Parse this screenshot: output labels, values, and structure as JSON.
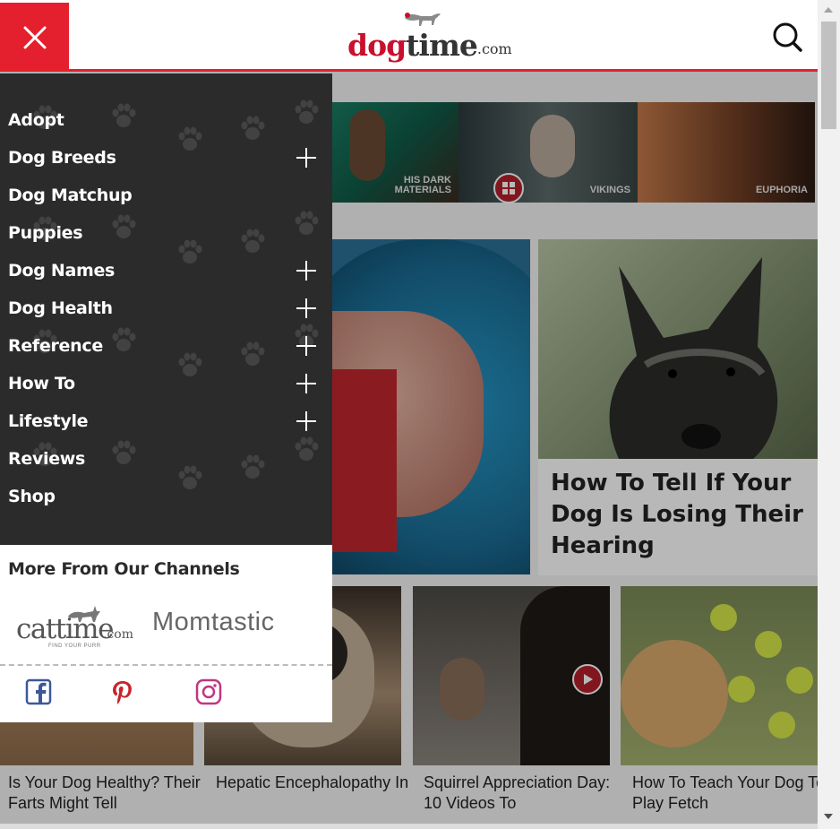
{
  "header": {
    "logo": {
      "dog": "dog",
      "time": "time",
      "com": ".com"
    },
    "close_icon": "close-icon",
    "search_icon": "search-icon"
  },
  "menu": {
    "items": [
      {
        "label": "Adopt",
        "expandable": false
      },
      {
        "label": "Dog Breeds",
        "expandable": true
      },
      {
        "label": "Dog Matchup",
        "expandable": false
      },
      {
        "label": "Puppies",
        "expandable": false
      },
      {
        "label": "Dog Names",
        "expandable": true
      },
      {
        "label": "Dog Health",
        "expandable": true
      },
      {
        "label": "Reference",
        "expandable": true
      },
      {
        "label": "How To",
        "expandable": true
      },
      {
        "label": "Lifestyle",
        "expandable": true
      },
      {
        "label": "Reviews",
        "expandable": false
      },
      {
        "label": "Shop",
        "expandable": false
      }
    ]
  },
  "channels": {
    "heading": "More From Our Channels",
    "cattime": {
      "word": "cattime",
      "com": ".com",
      "tagline": "FIND YOUR PURR"
    },
    "momtastic": "Momtastic",
    "social": [
      "facebook-icon",
      "pinterest-icon",
      "instagram-icon"
    ]
  },
  "content": {
    "strip": [
      {
        "label": "HIS DARK\nMATERIALS"
      },
      {
        "label": "VIKINGS"
      },
      {
        "label": "EUPHORIA"
      }
    ],
    "feature": {
      "title": "How To Tell If Your Dog Is Losing Their Hearing"
    },
    "tiles": [
      {
        "title": "Is Your Dog Healthy? Their Farts Might Tell"
      },
      {
        "title": "Hepatic Encephalopathy In"
      },
      {
        "title": "Squirrel Appreciation Day: 10 Videos To"
      },
      {
        "title": "How To Teach Your Dog To Play Fetch"
      }
    ]
  },
  "colors": {
    "brand_red": "#e5202e",
    "menu_bg": "#2b2b2b",
    "facebook": "#3b5998",
    "pinterest": "#c8232c",
    "instagram": "#c13584"
  }
}
